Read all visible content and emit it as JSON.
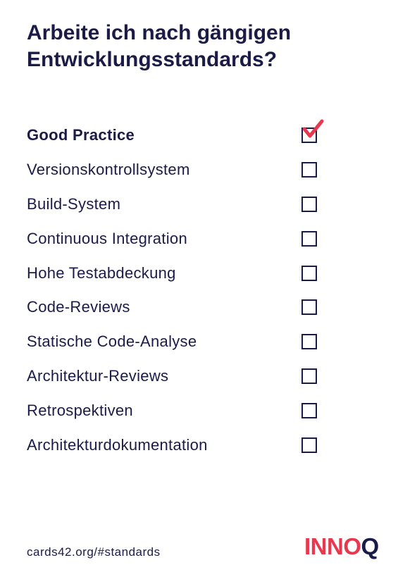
{
  "card": {
    "title_line1": "Arbeite ich nach gängigen",
    "title_line2": "Entwicklungsstandards?",
    "section_header": "Good Practice",
    "section_header_checked": true,
    "items": [
      {
        "label": "Versionskontrollsystem",
        "checked": false
      },
      {
        "label": "Build-System",
        "checked": false
      },
      {
        "label": "Continuous Integration",
        "checked": false
      },
      {
        "label": "Hohe Testabdeckung",
        "checked": false
      },
      {
        "label": "Code-Reviews",
        "checked": false
      },
      {
        "label": "Statische Code-Analyse",
        "checked": false
      },
      {
        "label": "Architektur-Reviews",
        "checked": false
      },
      {
        "label": "Retrospektiven",
        "checked": false
      },
      {
        "label": "Architekturdokumentation",
        "checked": false
      }
    ]
  },
  "footer": {
    "link_text": "cards42.org/#standards",
    "logo_part_pink": "INNO",
    "logo_part_navy": "Q"
  },
  "colors": {
    "text_navy": "#1b1b48",
    "accent_pink": "#e8384f",
    "background": "#ffffff"
  },
  "icons": {
    "checkbox": "checkbox-icon",
    "checkmark": "checkmark-icon"
  }
}
